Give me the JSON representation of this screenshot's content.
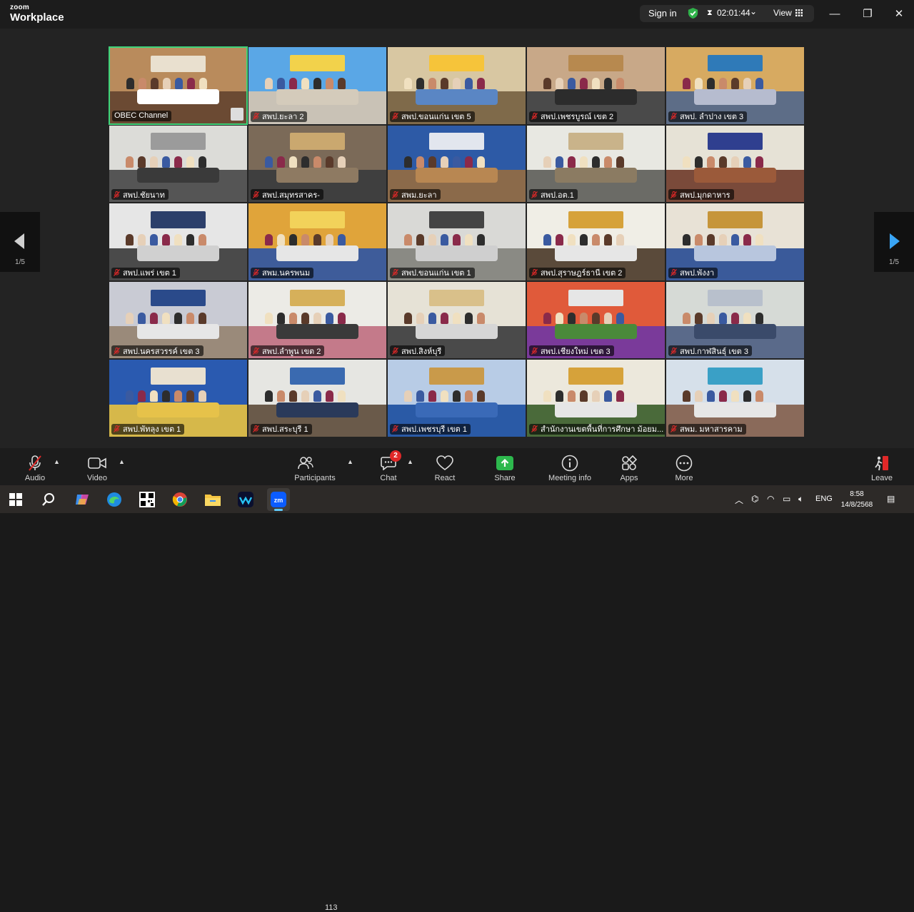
{
  "app": {
    "logo_line1": "zoom",
    "logo_line2": "Workplace",
    "sign_in": "Sign in",
    "timer": "02:01:44",
    "view": "View",
    "accent": "#3ed47a"
  },
  "paging": {
    "left": "1/5",
    "right": "1/5"
  },
  "tiles": [
    {
      "name": "OBEC Channel",
      "wall": "#b98b5c",
      "floor": "#6b4a33",
      "banner": "#e9e0cf",
      "table": "#ffffff",
      "muted": false
    },
    {
      "name": "สพป.ยะลา 2",
      "wall": "#5aa7e6",
      "floor": "#c9c2b6",
      "banner": "#f2d24b",
      "table": "#d4cbbb",
      "muted": true
    },
    {
      "name": "สพป.ขอนแก่น เขต 5",
      "wall": "#d8c7a2",
      "floor": "#7f6a4a",
      "banner": "#f6c43a",
      "table": "#5a86c4",
      "muted": true
    },
    {
      "name": "สพป.เพชรบูรณ์ เขต 2",
      "wall": "#c8a888",
      "floor": "#4a4a4a",
      "banner": "#b7894f",
      "table": "#2c2c2c",
      "muted": true
    },
    {
      "name": "สพป. ลำปาง เขต 3",
      "wall": "#d7aa61",
      "floor": "#5d6d87",
      "banner": "#2f7ab8",
      "table": "#b6bccf",
      "muted": true
    },
    {
      "name": "สพป.ชัยนาท",
      "wall": "#dcdcd8",
      "floor": "#555555",
      "banner": "#9b9b9b",
      "table": "#3a3a3a",
      "muted": true
    },
    {
      "name": "สพป.สมุทรสาคร-",
      "wall": "#7b6a58",
      "floor": "#3f3f3f",
      "banner": "#caa86f",
      "table": "#8e7a62",
      "muted": true
    },
    {
      "name": "สพม.ยะลา",
      "wall": "#2d5aa6",
      "floor": "#8b6a4a",
      "banner": "#e2e6ee",
      "table": "#b88752",
      "muted": true
    },
    {
      "name": "สพป.อต.1",
      "wall": "#e8e8e2",
      "floor": "#6b6b66",
      "banner": "#c9b38a",
      "table": "#8b7b62",
      "muted": true
    },
    {
      "name": "สพป.มุกดาหาร",
      "wall": "#e6e2d6",
      "floor": "#7a4a3a",
      "banner": "#2f3f8f",
      "table": "#9b5a3a",
      "muted": true
    },
    {
      "name": "สพป.แพร่ เขต 1",
      "wall": "#e6e6e6",
      "floor": "#4a4a4a",
      "banner": "#2c3f6a",
      "table": "#d0d0d0",
      "muted": true
    },
    {
      "name": "สพม.นครพนม",
      "wall": "#e0a43a",
      "floor": "#3e5c9a",
      "banner": "#f2d25a",
      "table": "#e6e6e6",
      "muted": true
    },
    {
      "name": "สพป.ขอนแก่น เขต 1",
      "wall": "#d9d9d6",
      "floor": "#8a8a84",
      "banner": "#444444",
      "table": "#cfcfcf",
      "muted": true
    },
    {
      "name": "สพป.สุราษฎร์ธานี เขต 2",
      "wall": "#f0eee6",
      "floor": "#5a4a3a",
      "banner": "#d6a23a",
      "table": "#e6e6e6",
      "muted": true
    },
    {
      "name": "สพป.พังงา",
      "wall": "#e8e2d6",
      "floor": "#3a5a9a",
      "banner": "#c6953a",
      "table": "#b8c6de",
      "muted": true
    },
    {
      "name": "สพป.นครสวรรค์ เขต 3",
      "wall": "#c9cbd4",
      "floor": "#9a8a7a",
      "banner": "#2a4a8a",
      "table": "#e6e6e6",
      "muted": true
    },
    {
      "name": "สพป.ลำพูน เขต 2",
      "wall": "#ecebe6",
      "floor": "#c47a8a",
      "banner": "#d6b05a",
      "table": "#3a3a3a",
      "muted": true
    },
    {
      "name": "สพป.สิงห์บุรี",
      "wall": "#e6e2d6",
      "floor": "#4a4a4a",
      "banner": "#d9c08a",
      "table": "#d6d6d6",
      "muted": true
    },
    {
      "name": "สพป.เชียงใหม่ เขต 3",
      "wall": "#e05a3a",
      "floor": "#7a3a9a",
      "banner": "#e6e6e6",
      "table": "#4a8a3a",
      "muted": true
    },
    {
      "name": "สพป.กาฬสินธุ์ เขต 3",
      "wall": "#d6dad6",
      "floor": "#5a6a8a",
      "banner": "#b8c0cc",
      "table": "#3a4a6a",
      "muted": true
    },
    {
      "name": "สพป.พัทลุง เขต 1",
      "wall": "#2a5ab0",
      "floor": "#d6b84a",
      "banner": "#e8e0d0",
      "table": "#e6c24a",
      "muted": true
    },
    {
      "name": "สพป.สระบุรี 1",
      "wall": "#e6e6e2",
      "floor": "#6a5a4a",
      "banner": "#3a6ab0",
      "table": "#2a3a5a",
      "muted": true
    },
    {
      "name": "สพป.เพชรบุรี เขต 1",
      "wall": "#b8cce6",
      "floor": "#2a5aa6",
      "banner": "#c99a4a",
      "table": "#3a6ab8",
      "muted": true
    },
    {
      "name": "สำนักงานเขตพื้นที่การศึกษา ม้อยม...",
      "wall": "#ece8dc",
      "floor": "#4a6a3a",
      "banner": "#d6a23a",
      "table": "#e6e6e6",
      "muted": true
    },
    {
      "name": "สพม. มหาสารคาม",
      "wall": "#d6e0ea",
      "floor": "#8a6a5a",
      "banner": "#3aa0c6",
      "table": "#e6e6e6",
      "muted": true
    }
  ],
  "toolbar": {
    "audio": "Audio",
    "video": "Video",
    "participants": "Participants",
    "participant_count": "113",
    "chat": "Chat",
    "chat_badge": "2",
    "react": "React",
    "share": "Share",
    "meeting_info": "Meeting info",
    "apps": "Apps",
    "more": "More",
    "leave": "Leave",
    "share_color": "#2db84d",
    "leave_color": "#e02828"
  },
  "taskbar": {
    "lang": "ENG",
    "time": "8:58",
    "date": "14/8/2568",
    "apps": [
      "windows-start",
      "search",
      "copilot",
      "edge",
      "qr-app",
      "chrome",
      "file-explorer",
      "webex",
      "zoom"
    ]
  }
}
